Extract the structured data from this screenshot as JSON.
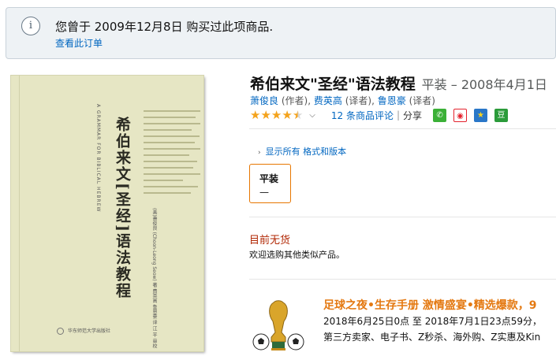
{
  "notice": {
    "message": "您曾于 2009年12月8日 购买过此项商品.",
    "order_link": "查看此订单"
  },
  "cover": {
    "title": "希伯来文[圣经]语法教程",
    "english_subtitle": "A GRAMMAR FOR BIBLICAL HEBREW",
    "authors": "(美)萧俊良 (Choon-Leong Seow) 著    费英高 鲁恩豪 译    江  平 审校",
    "publisher": "华东师范大学出版社"
  },
  "product": {
    "title": "希伯来文\"圣经\"语法教程",
    "format_date": "平装 – 2008年4月1日",
    "contributors": [
      {
        "name": "萧俊良",
        "role": "(作者)"
      },
      {
        "name": "费英高",
        "role": "(译者)"
      },
      {
        "name": "鲁恩豪",
        "role": "(译者)"
      }
    ],
    "rating_stars": 4.5,
    "reviews_link": "12 条商品评论",
    "share_label": "分享",
    "share_icons": [
      "wechat-icon",
      "weibo-icon",
      "qzone-icon",
      "douban-icon"
    ],
    "show_formats_link": "显示所有 格式和版本",
    "format_option": {
      "label": "平装",
      "price": "—"
    },
    "availability": "目前无货",
    "availability_note": "欢迎选购其他类似产品。"
  },
  "promo": {
    "title": "足球之夜•生存手册 激情盛宴•精选爆款，9",
    "dates": "2018年6月25日0点 至 2018年7月1日23点59分，",
    "categories": "第三方卖家、电子书、Z秒杀、海外购、Z实惠及Kin"
  },
  "colors": {
    "link": "#0066c0",
    "price_red": "#b12704",
    "promo_orange": "#e47911",
    "star": "#f4a31c",
    "selected_border": "#e77600"
  }
}
